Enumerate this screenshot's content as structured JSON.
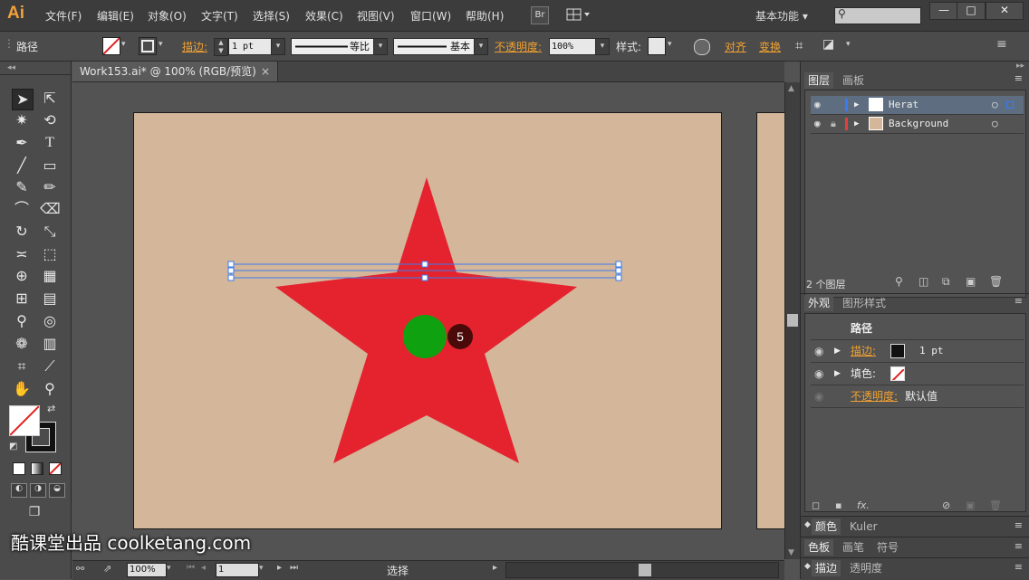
{
  "app": {
    "logo": "Ai"
  },
  "menu": [
    "文件(F)",
    "编辑(E)",
    "对象(O)",
    "文字(T)",
    "选择(S)",
    "效果(C)",
    "视图(V)",
    "窗口(W)",
    "帮助(H)"
  ],
  "bridge_button": "Br",
  "workspace": "基本功能",
  "window_buttons": {
    "minimize": "—",
    "restore": "□",
    "close": "✕"
  },
  "control": {
    "object_type": "路径",
    "stroke_label": "描边:",
    "stroke_weight": "1 pt",
    "profile_label": "等比",
    "brush_label": "基本",
    "opacity_label": "不透明度:",
    "opacity_value": "100%",
    "style_label": "样式:",
    "align_label": "对齐",
    "transform_label": "变换"
  },
  "document": {
    "tab_title": "Work153.ai* @ 100% (RGB/预览)",
    "close": "×"
  },
  "step_marker": "5",
  "status": {
    "zoom": "100%",
    "artboard": "1",
    "tool": "选择"
  },
  "layers_panel": {
    "tabs": [
      "图层",
      "画板"
    ],
    "layers": [
      {
        "name": "Herat",
        "color": "#3a7cf0"
      },
      {
        "name": "Background",
        "color": "#e04040"
      }
    ],
    "count": "2 个图层"
  },
  "appearance_panel": {
    "tabs": [
      "外观",
      "图形样式"
    ],
    "title": "路径",
    "stroke_label": "描边:",
    "stroke_value": "1 pt",
    "fill_label": "填色:",
    "opacity_label": "不透明度:",
    "opacity_value": "默认值"
  },
  "collapsed_panels": [
    {
      "tabs": [
        "颜色",
        "Kuler"
      ]
    },
    {
      "tabs": [
        "色板",
        "画笔",
        "符号"
      ]
    },
    {
      "tabs": [
        "描边",
        "透明度"
      ]
    }
  ],
  "watermark": "酷课堂出品 coolketang.com",
  "colors": {
    "star": "#e4232f",
    "circle": "#0fa10f",
    "artboard": "#d4b69a",
    "accent_orange": "#f0a030"
  }
}
